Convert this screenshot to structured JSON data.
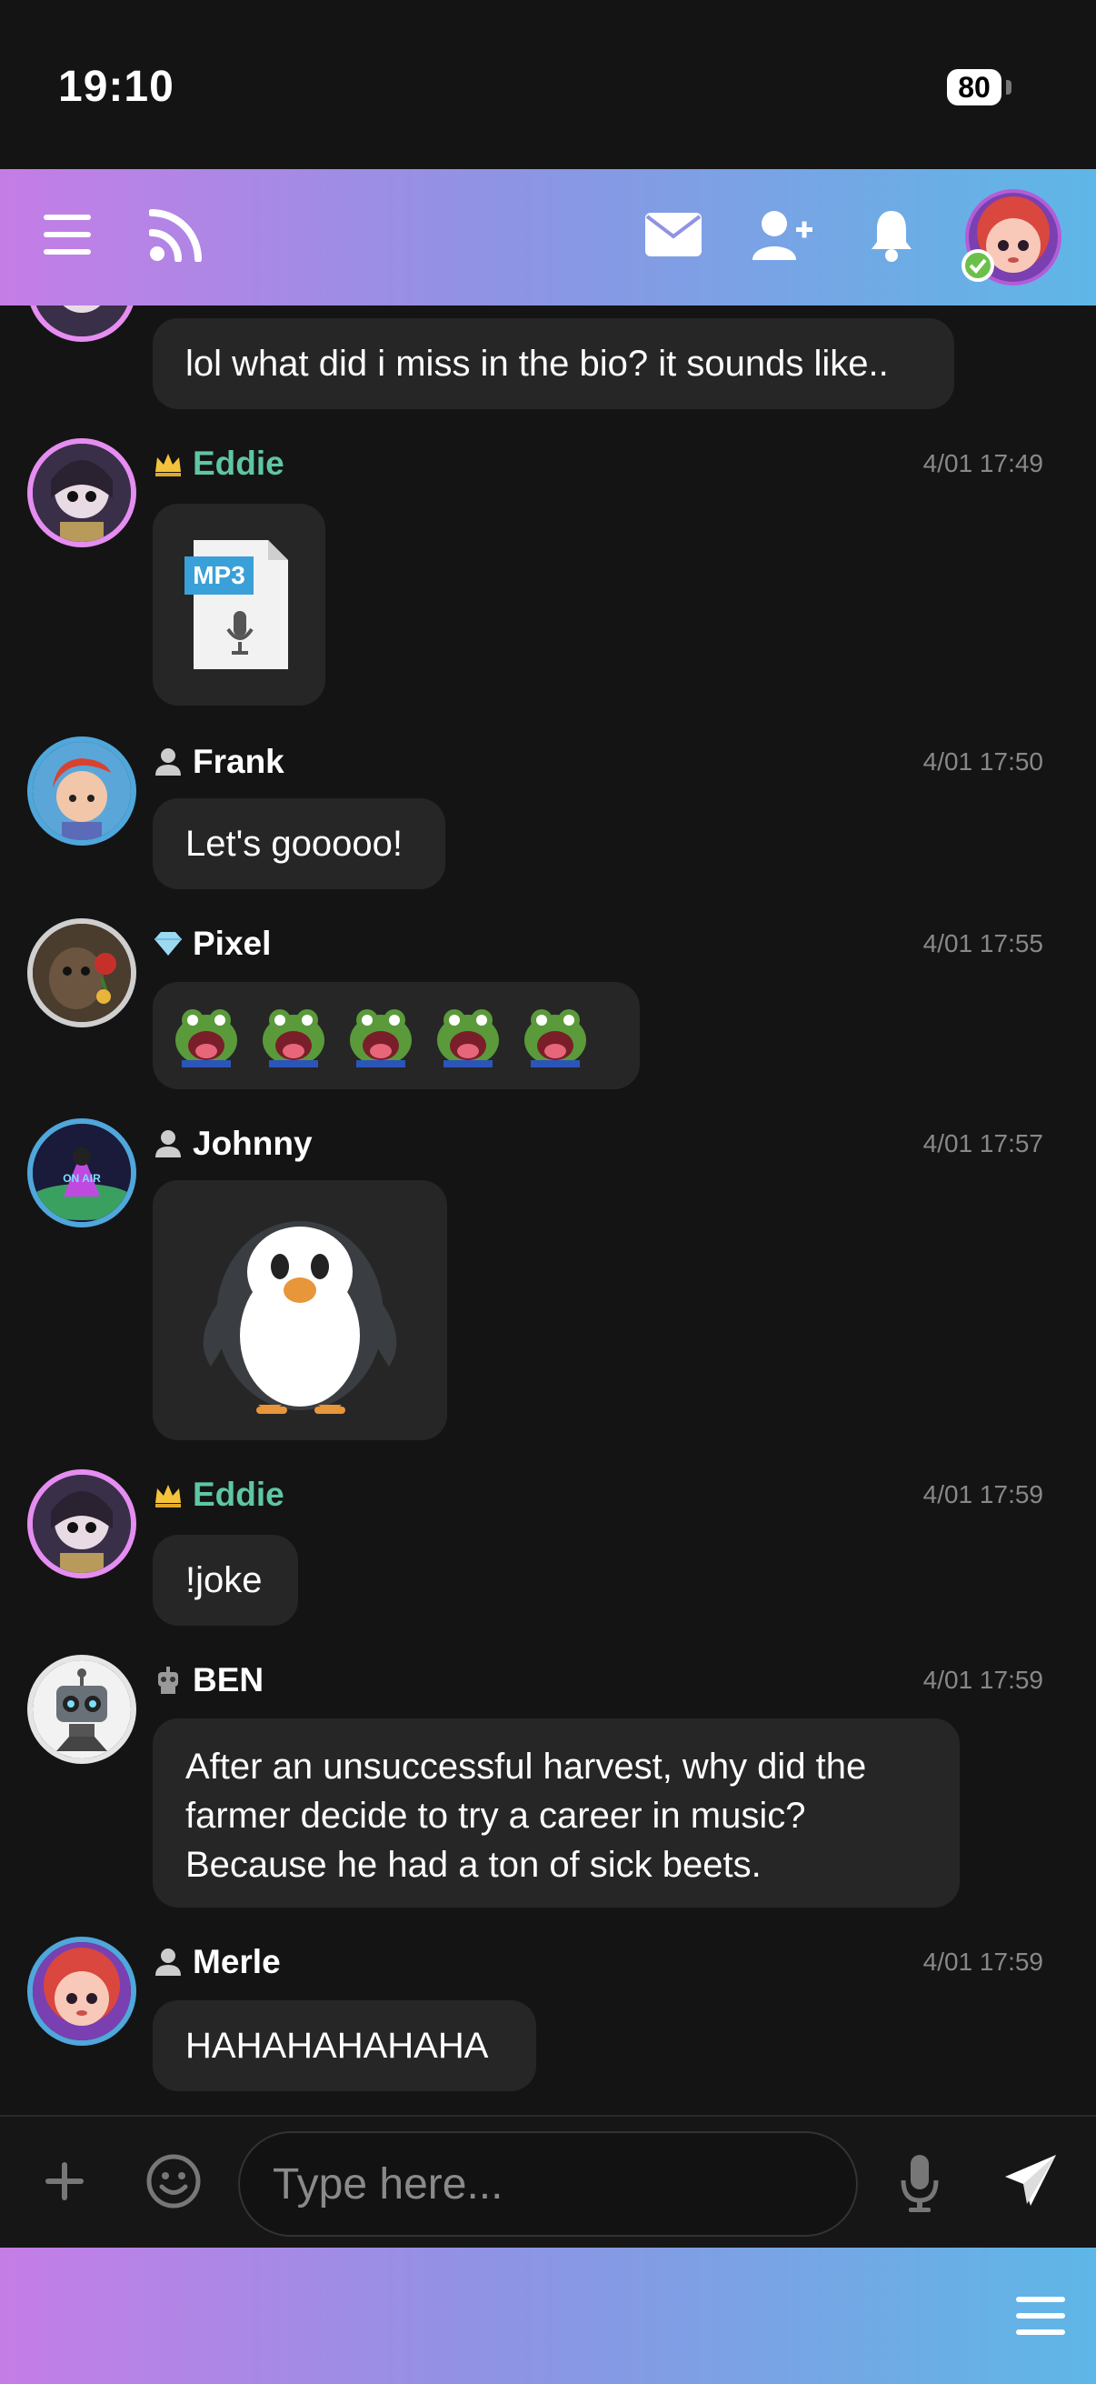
{
  "status_bar": {
    "time": "19:10",
    "battery": "80"
  },
  "top_bar": {
    "icons": [
      "menu-icon",
      "rss-icon",
      "mail-icon",
      "add-friend-icon",
      "bell-icon",
      "avatar"
    ],
    "gradient_start": "#c57de6",
    "gradient_end": "#5eb7e6"
  },
  "messages": [
    {
      "author": "",
      "role": "",
      "time": "",
      "text": "lol what did i miss in the bio? it sounds like.."
    },
    {
      "author": "Eddie",
      "role": "crown-icon",
      "time": "4/01 17:49",
      "attachment": "MP3"
    },
    {
      "author": "Frank",
      "role": "user-icon",
      "time": "4/01 17:50",
      "text": "Let's gooooo!"
    },
    {
      "author": "Pixel",
      "role": "diamond-icon",
      "time": "4/01 17:55",
      "emotes": [
        "frog-emote",
        "frog-emote",
        "frog-emote",
        "frog-emote",
        "frog-emote"
      ]
    },
    {
      "author": "Johnny",
      "role": "user-icon",
      "time": "4/01 17:57",
      "sticker": "penguin-sticker"
    },
    {
      "author": "Eddie",
      "role": "crown-icon",
      "time": "4/01 17:59",
      "text": "!joke"
    },
    {
      "author": "BEN",
      "role": "robot-icon",
      "time": "4/01 17:59",
      "text_lines": [
        "After an unsuccessful harvest, why did the",
        "farmer decide to try a career in music?",
        "Because he had a ton of sick beets."
      ]
    },
    {
      "author": "Merle",
      "role": "user-icon",
      "time": "4/01 17:59",
      "text": "HAHAHAHAHAHA"
    }
  ],
  "composer": {
    "placeholder": "Type here...",
    "value": ""
  },
  "bottom_bar": {
    "icon": "menu-icon"
  }
}
